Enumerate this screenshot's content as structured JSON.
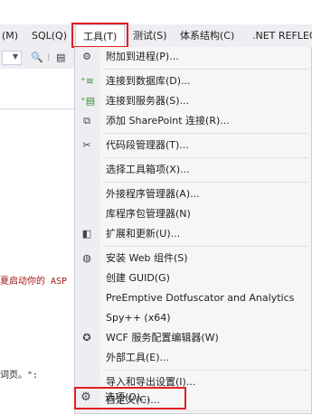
{
  "menubar": {
    "items": [
      {
        "label": "(M)"
      },
      {
        "label": "SQL(Q)"
      },
      {
        "label": "工具(T)"
      },
      {
        "label": "测试(S)"
      },
      {
        "label": "体系结构(C)"
      },
      {
        "label": ".NET REFLEC"
      }
    ]
  },
  "editor": {
    "lines": [
      "夏启动你的 ASP",
      "词页。\":"
    ]
  },
  "tools_menu": {
    "items": [
      {
        "label": "附加到进程(P)...",
        "icon": "attach-process-icon"
      },
      {
        "label": "连接到数据库(D)...",
        "icon": "connect-database-icon"
      },
      {
        "label": "连接到服务器(S)...",
        "icon": "connect-server-icon"
      },
      {
        "label": "添加 SharePoint 连接(R)...",
        "icon": "sharepoint-connection-icon"
      },
      {
        "label": "代码段管理器(T)...",
        "icon": "code-snippets-icon"
      },
      {
        "label": "选择工具箱项(X)...",
        "icon": ""
      },
      {
        "label": "外接程序管理器(A)...",
        "icon": ""
      },
      {
        "label": "库程序包管理器(N)",
        "icon": ""
      },
      {
        "label": "扩展和更新(U)...",
        "icon": "extensions-icon"
      },
      {
        "label": "安装 Web 组件(S)",
        "icon": "web-components-icon"
      },
      {
        "label": "创建 GUID(G)",
        "icon": ""
      },
      {
        "label": "PreEmptive Dotfuscator and Analytics",
        "icon": ""
      },
      {
        "label": "Spy++ (x64)",
        "icon": ""
      },
      {
        "label": "WCF 服务配置编辑器(W)",
        "icon": "wcf-config-icon"
      },
      {
        "label": "外部工具(E)...",
        "icon": ""
      },
      {
        "label": "导入和导出设置(I)...",
        "icon": ""
      },
      {
        "label": "自定义(C)...",
        "icon": ""
      },
      {
        "label": "选项(O)...",
        "icon": "gear-icon"
      }
    ]
  }
}
